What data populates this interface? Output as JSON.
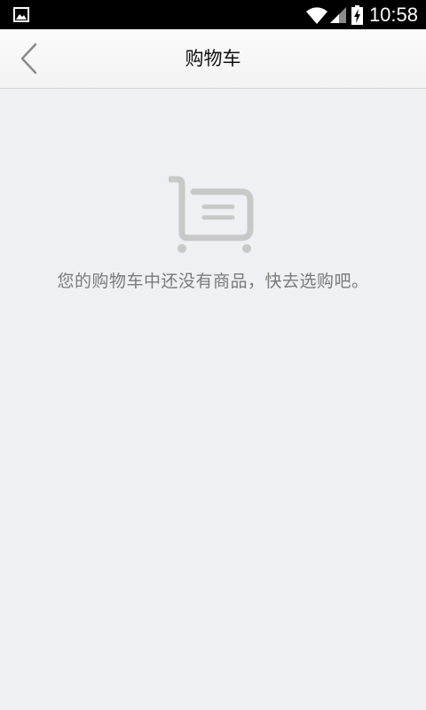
{
  "status_bar": {
    "time": "10:58",
    "left_icon": "image-icon",
    "right_icons": [
      "wifi-icon",
      "signal-icon",
      "battery-charging-icon"
    ]
  },
  "header": {
    "title": "购物车",
    "back_icon": "chevron-left-icon"
  },
  "empty_state": {
    "icon": "shopping-cart-icon",
    "message": "您的购物车中还没有商品，快去选购吧。"
  },
  "colors": {
    "background": "#eff0f4",
    "status_bar": "#000000",
    "header": "#f7f7f7",
    "icon_gray": "#c8c8c8",
    "message_text": "#7a7a7a"
  }
}
